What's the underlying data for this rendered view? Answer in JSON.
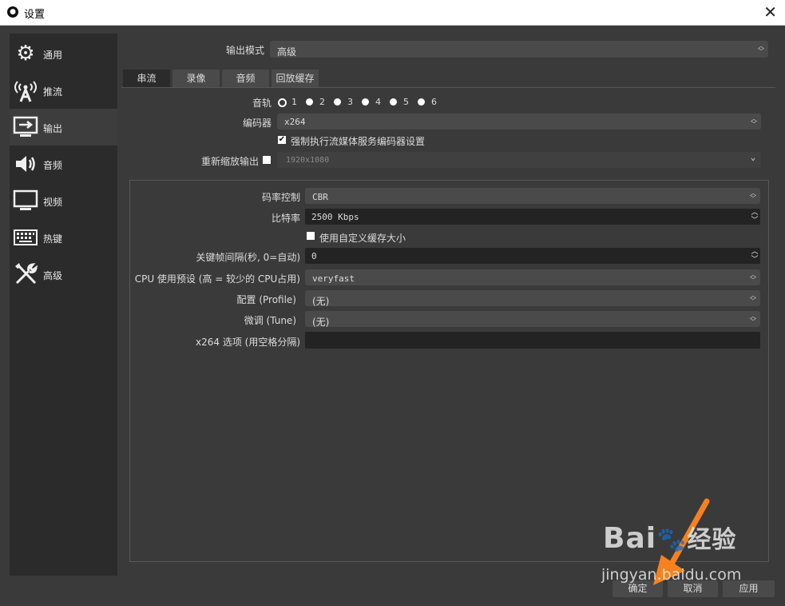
{
  "window": {
    "title": "设置",
    "logo": "obs-logo-icon",
    "close": "✕"
  },
  "sidebar": {
    "items": [
      {
        "label": "通用",
        "icon": "gear-icon",
        "glyph": "⚙"
      },
      {
        "label": "推流",
        "icon": "broadcast-antenna-icon",
        "glyph": "📡"
      },
      {
        "label": "输出",
        "icon": "monitor-output-icon",
        "glyph": "⇨"
      },
      {
        "label": "音频",
        "icon": "speaker-icon",
        "glyph": "🔊"
      },
      {
        "label": "视频",
        "icon": "monitor-icon",
        "glyph": "🖵"
      },
      {
        "label": "热键",
        "icon": "keyboard-icon",
        "glyph": "⌨"
      },
      {
        "label": "高级",
        "icon": "tools-icon",
        "glyph": "🛠"
      }
    ],
    "active": "输出"
  },
  "output_mode": {
    "label": "输出模式",
    "value": "高级"
  },
  "tabs": [
    "串流",
    "录像",
    "音频",
    "回放缓存"
  ],
  "active_tab": "串流",
  "streaming": {
    "audio_track_label": "音轨",
    "audio_tracks": [
      "1",
      "2",
      "3",
      "4",
      "5",
      "6"
    ],
    "selected_track": "1",
    "encoder_label": "编码器",
    "encoder_value": "x264",
    "enforce_label": "强制执行流媒体服务编码器设置",
    "enforce_checked": true,
    "rescale_label": "重新缩放输出",
    "rescale_checked": false,
    "rescale_value": "1920x1080"
  },
  "encoder_settings": {
    "rate_control_label": "码率控制",
    "rate_control_value": "CBR",
    "bitrate_label": "比特率",
    "bitrate_value": "2500 Kbps",
    "custom_buffer_label": "使用自定义缓存大小",
    "custom_buffer_checked": false,
    "keyframe_label": "关键帧间隔(秒, 0=自动)",
    "keyframe_value": "0",
    "cpu_preset_label": "CPU 使用预设 (高 = 较少的 CPU占用)",
    "cpu_preset_value": "veryfast",
    "profile_label": "配置 (Profile)",
    "profile_value": "(无)",
    "tune_label": "微调 (Tune)",
    "tune_value": "(无)",
    "x264_opts_label": "x264 选项 (用空格分隔)",
    "x264_opts_value": ""
  },
  "buttons": {
    "ok": "确定",
    "cancel": "取消",
    "apply": "应用"
  },
  "watermark": {
    "brand": "Bai",
    "brand2": "经验",
    "url": "jingyan.baidu.com"
  },
  "colors": {
    "accent_arrow": "#f5821f",
    "panel": "#3a3a3a",
    "sidebar": "#2b2b2b",
    "field": "#232323"
  }
}
